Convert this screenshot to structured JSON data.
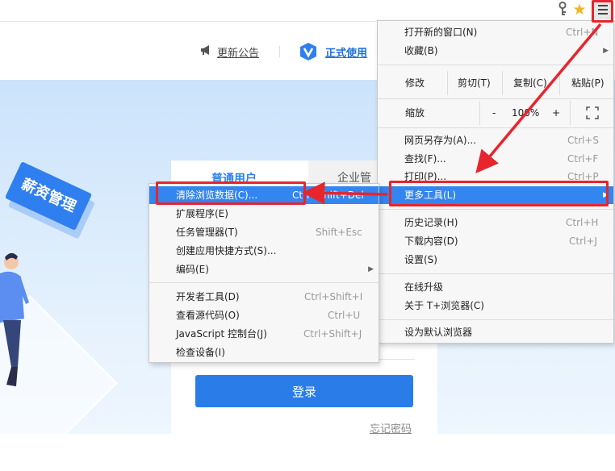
{
  "toolbar": {
    "key_icon": "key-icon",
    "star_icon": "star-icon",
    "menu_icon": "hamburger-menu-icon"
  },
  "site": {
    "announce_label": "更新公告",
    "official_label": "正式使用",
    "tabs": {
      "normal": "普通用户",
      "enterprise": "企业管"
    },
    "badge_label": "薪资管理",
    "login_label": "登录",
    "forgot_label": "忘记密码"
  },
  "main_menu": {
    "new_window": {
      "label": "打开新的窗口(N)",
      "shortcut": "Ctrl+N"
    },
    "favorites": {
      "label": "收藏(B)"
    },
    "edit": {
      "label": "修改",
      "cut": "剪切(T)",
      "copy": "复制(C)",
      "paste": "粘贴(P)"
    },
    "zoom": {
      "label": "缩放",
      "minus": "-",
      "value": "100%",
      "plus": "+"
    },
    "save_as": {
      "label": "网页另存为(A)...",
      "shortcut": "Ctrl+S"
    },
    "find": {
      "label": "查找(F)...",
      "shortcut": "Ctrl+F"
    },
    "print": {
      "label": "打印(P)...",
      "shortcut": "Ctrl+P"
    },
    "more_tools": {
      "label": "更多工具(L)"
    },
    "history": {
      "label": "历史记录(H)",
      "shortcut": "Ctrl+H"
    },
    "downloads": {
      "label": "下载内容(D)",
      "shortcut": "Ctrl+J"
    },
    "settings": {
      "label": "设置(S)"
    },
    "upgrade": {
      "label": "在线升级"
    },
    "about": {
      "label": "关于 T+浏览器(C)"
    },
    "set_default": {
      "label": "设为默认浏览器"
    }
  },
  "sub_menu": {
    "clear_data": {
      "label": "清除浏览数据(C)...",
      "shortcut": "Ctrl+Shift+Del"
    },
    "extensions": {
      "label": "扩展程序(E)"
    },
    "task_manager": {
      "label": "任务管理器(T)",
      "shortcut": "Shift+Esc"
    },
    "create_shortcut": {
      "label": "创建应用快捷方式(S)..."
    },
    "encoding": {
      "label": "编码(E)"
    },
    "dev_tools": {
      "label": "开发者工具(D)",
      "shortcut": "Ctrl+Shift+I"
    },
    "view_source": {
      "label": "查看源代码(O)",
      "shortcut": "Ctrl+U"
    },
    "js_console": {
      "label": "JavaScript 控制台(J)",
      "shortcut": "Ctrl+Shift+J"
    },
    "inspect_devices": {
      "label": "检查设备(I)"
    }
  },
  "colors": {
    "highlight": "#3385f0",
    "annotation_red": "#e8242c",
    "brand_blue": "#2a7de9"
  }
}
